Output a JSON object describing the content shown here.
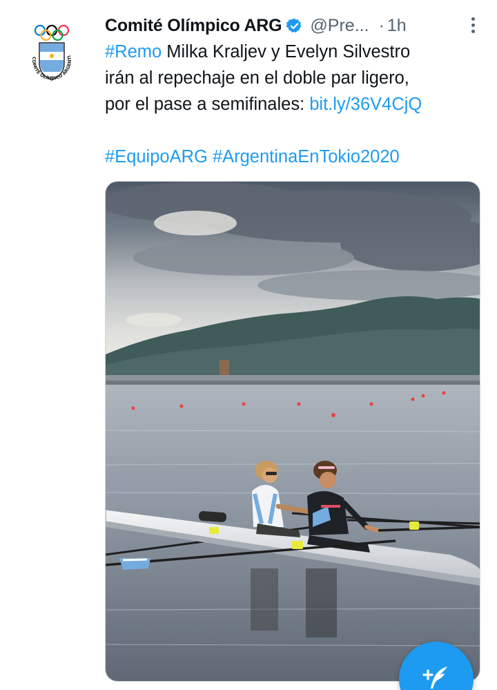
{
  "tweet": {
    "display_name": "Comité Olímpico ARG",
    "handle": "@Pre...",
    "separator": "·",
    "time": "1h",
    "text_lines": [
      {
        "parts": [
          {
            "text": "#Remo",
            "link": true
          },
          {
            "text": " Milka Kraljev y Evelyn Silvestro",
            "link": false
          }
        ]
      },
      {
        "parts": [
          {
            "text": "irán al repechaje en el doble par ligero,",
            "link": false
          }
        ]
      },
      {
        "parts": [
          {
            "text": "por el pase a semifinales: ",
            "link": false
          },
          {
            "text": "bit.ly/36V4CjQ",
            "link": true
          }
        ]
      }
    ],
    "hashtags_line": [
      {
        "text": "#EquipoARG",
        "link": true
      },
      {
        "text": " ",
        "link": false
      },
      {
        "text": "#ArgentinaEnTokio2020",
        "link": true
      }
    ],
    "avatar_text": "COMITÉ OLÍMPICO ARGENTINO"
  },
  "icons": {
    "verified": "verified-badge-icon",
    "more": "more-vertical-icon",
    "compose": "compose-tweet-icon"
  },
  "colors": {
    "link": "#1d9bf0",
    "text": "#0f1419",
    "secondary": "#536471",
    "fab": "#1d9bf0"
  }
}
